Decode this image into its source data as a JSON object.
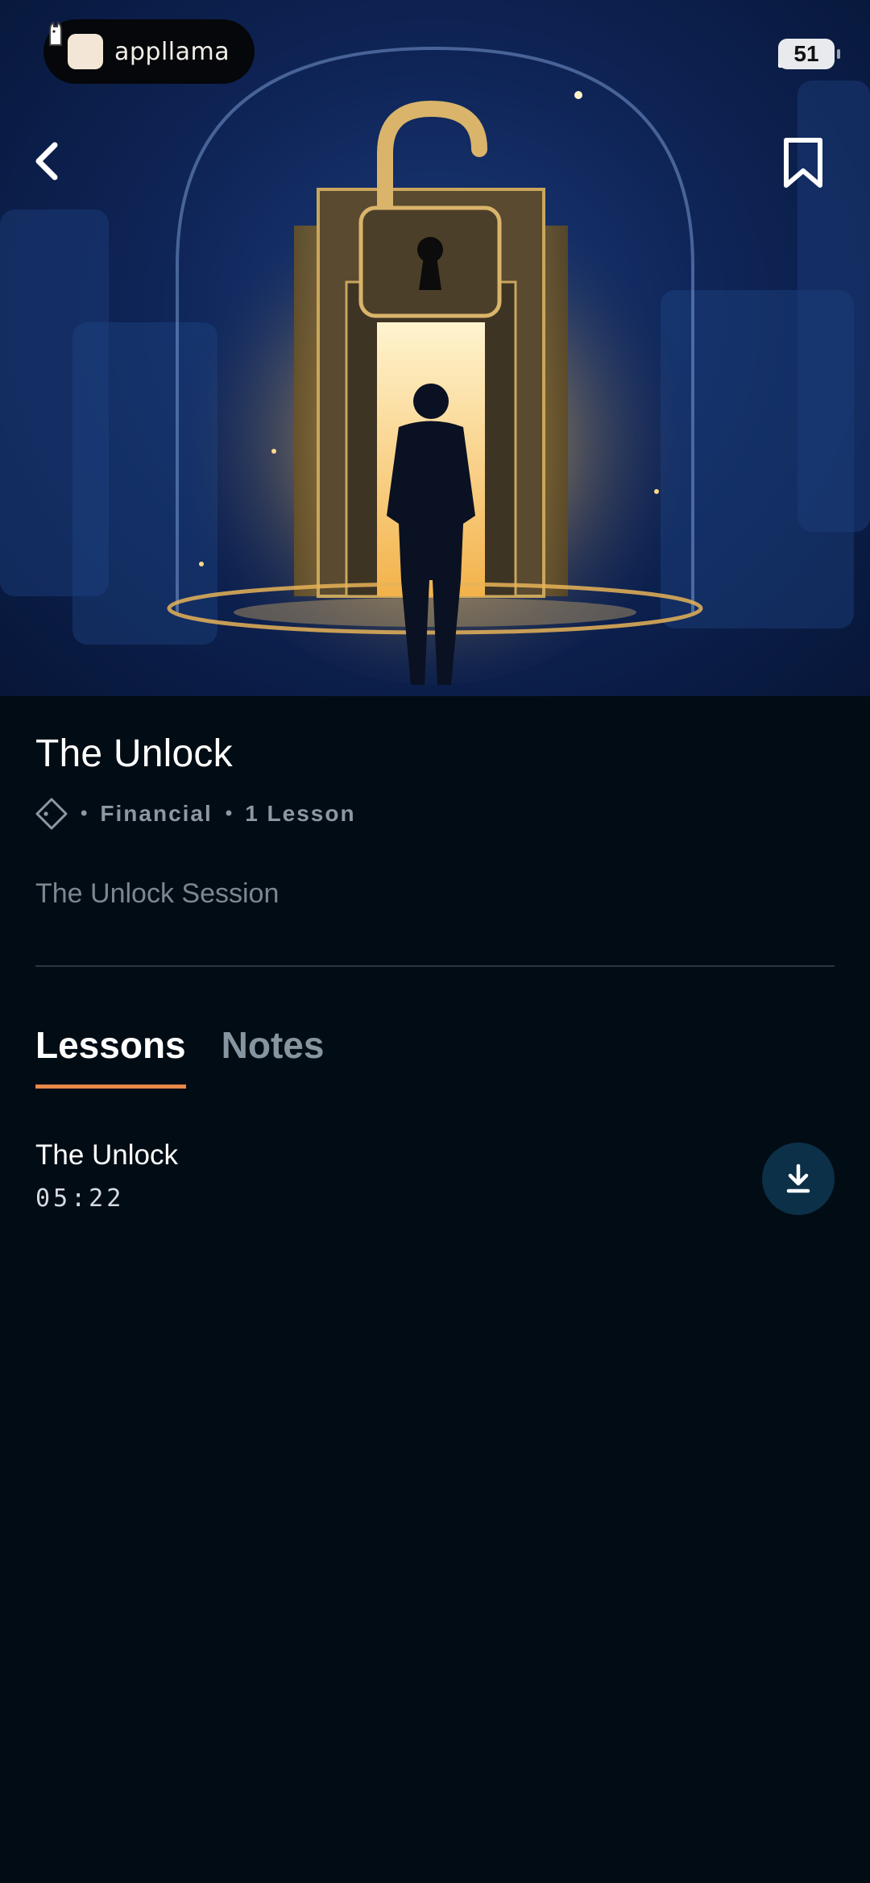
{
  "status_bar": {
    "recorder_app": "appllama",
    "battery": "51"
  },
  "hero": {
    "image_description_icon": "unlocked-padlock-door-illustration"
  },
  "icons": {
    "back": "chevron-left-icon",
    "bookmark": "bookmark-icon",
    "category": "diamond-tag-icon",
    "download": "download-icon"
  },
  "course": {
    "title": "The Unlock",
    "category": "Financial",
    "lesson_count": "1 Lesson",
    "subtitle": "The Unlock Session"
  },
  "tabs": [
    {
      "label": "Lessons",
      "active": true
    },
    {
      "label": "Notes",
      "active": false
    }
  ],
  "lessons": [
    {
      "title": "The Unlock",
      "duration": "05:22"
    }
  ],
  "colors": {
    "background": "#020c14",
    "tab_indicator": "#e8894a",
    "download_button": "#0c3048"
  }
}
